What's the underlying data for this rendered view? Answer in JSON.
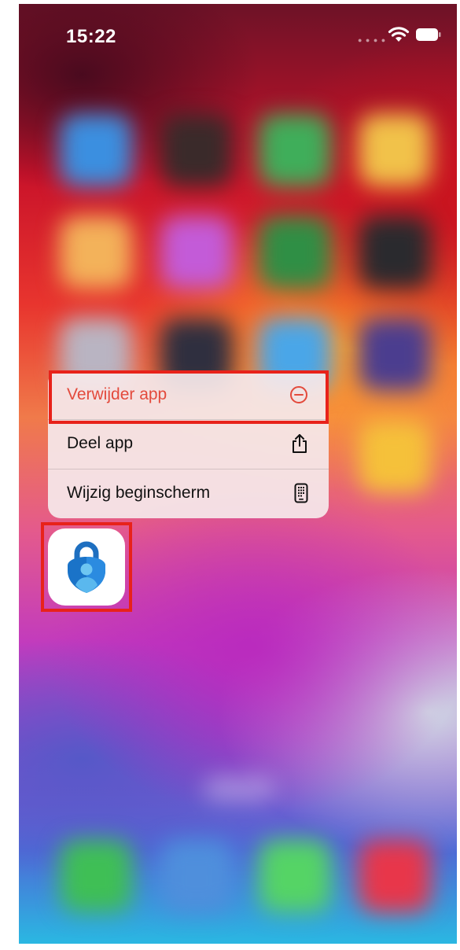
{
  "status_bar": {
    "time": "15:22"
  },
  "context_menu": {
    "items": [
      {
        "label": "Verwijder app",
        "icon": "minus-circle-icon",
        "color": "#e34a3c"
      },
      {
        "label": "Deel app",
        "icon": "share-icon"
      },
      {
        "label": "Wijzig beginscherm",
        "icon": "phone-grid-icon"
      }
    ]
  },
  "app": {
    "icon": "microsoft-authenticator-icon"
  },
  "colors": {
    "highlight": "#e8221a",
    "destructive": "#e34a3c"
  }
}
